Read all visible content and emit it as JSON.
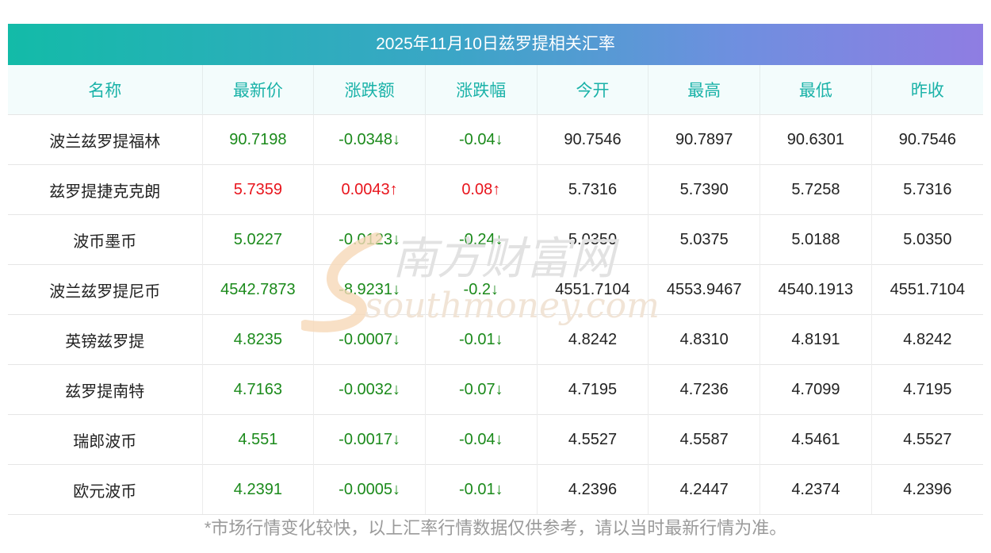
{
  "title": "2025年11月10日兹罗提相关汇率",
  "headers": [
    "名称",
    "最新价",
    "涨跌额",
    "涨跌幅",
    "今开",
    "最高",
    "最低",
    "昨收"
  ],
  "rows": [
    {
      "name": "波兰兹罗提福林",
      "latest": "90.7198",
      "change": "-0.0348↓",
      "pct": "-0.04↓",
      "open": "90.7546",
      "high": "90.7897",
      "low": "90.6301",
      "prev": "90.7546",
      "trend": "down"
    },
    {
      "name": "兹罗提捷克克朗",
      "latest": "5.7359",
      "change": "0.0043↑",
      "pct": "0.08↑",
      "open": "5.7316",
      "high": "5.7390",
      "low": "5.7258",
      "prev": "5.7316",
      "trend": "up"
    },
    {
      "name": "波币墨币",
      "latest": "5.0227",
      "change": "-0.0123↓",
      "pct": "-0.24↓",
      "open": "5.0350",
      "high": "5.0375",
      "low": "5.0188",
      "prev": "5.0350",
      "trend": "down"
    },
    {
      "name": "波兰兹罗提尼币",
      "latest": "4542.7873",
      "change": "-8.9231↓",
      "pct": "-0.2↓",
      "open": "4551.7104",
      "high": "4553.9467",
      "low": "4540.1913",
      "prev": "4551.7104",
      "trend": "down"
    },
    {
      "name": "英镑兹罗提",
      "latest": "4.8235",
      "change": "-0.0007↓",
      "pct": "-0.01↓",
      "open": "4.8242",
      "high": "4.8310",
      "low": "4.8191",
      "prev": "4.8242",
      "trend": "down"
    },
    {
      "name": "兹罗提南特",
      "latest": "4.7163",
      "change": "-0.0032↓",
      "pct": "-0.07↓",
      "open": "4.7195",
      "high": "4.7236",
      "low": "4.7099",
      "prev": "4.7195",
      "trend": "down"
    },
    {
      "name": "瑞郎波币",
      "latest": "4.551",
      "change": "-0.0017↓",
      "pct": "-0.04↓",
      "open": "4.5527",
      "high": "4.5587",
      "low": "4.5461",
      "prev": "4.5527",
      "trend": "down"
    },
    {
      "name": "欧元波币",
      "latest": "4.2391",
      "change": "-0.0005↓",
      "pct": "-0.01↓",
      "open": "4.2396",
      "high": "4.2447",
      "low": "4.2374",
      "prev": "4.2396",
      "trend": "down"
    }
  ],
  "watermark": {
    "cn": "南方财富网",
    "en": "southmoney.com"
  },
  "colors": {
    "up": "#e8151d",
    "down": "#1b8a1b",
    "header_text": "#1ab2a8"
  },
  "note": "*市场行情变化较快，以上汇率行情数据仅供参考，请以当时最新行情为准。"
}
